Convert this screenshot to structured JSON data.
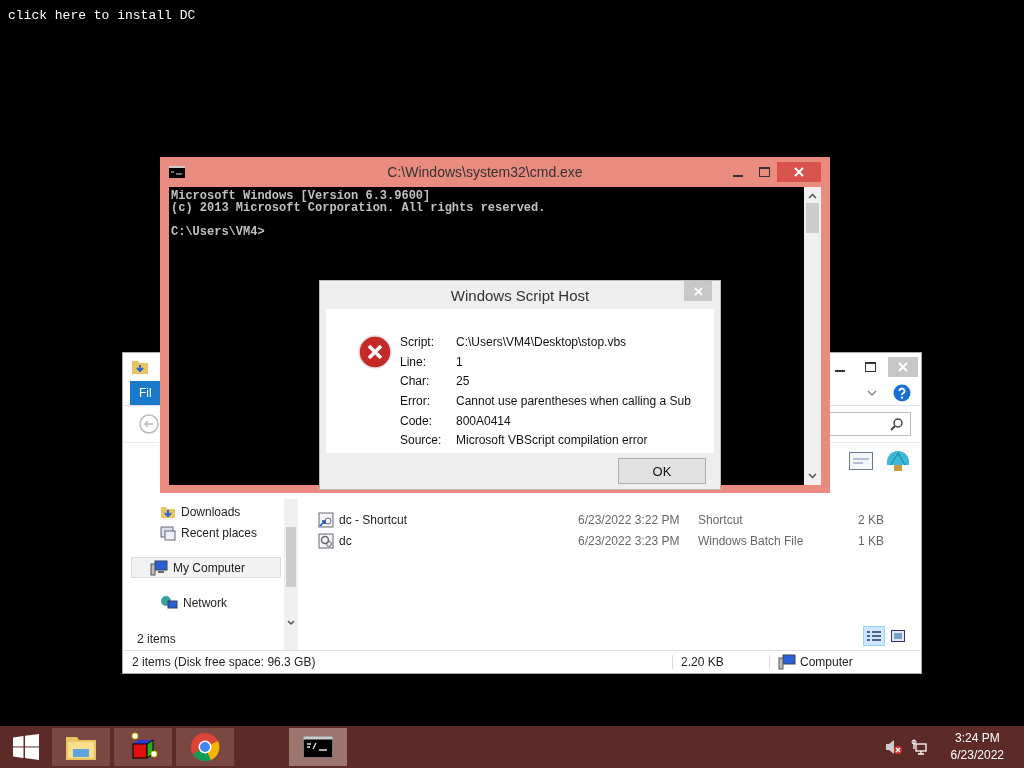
{
  "desktop_label": "click here to install DC",
  "explorer": {
    "tabs": [
      {
        "label": "Fil",
        "selected": true
      }
    ],
    "sidebar": {
      "groups": [
        {
          "items": [
            {
              "label": "Downloads",
              "kind": "downloads",
              "selected": false
            },
            {
              "label": "Recent places",
              "kind": "recent",
              "selected": false
            }
          ]
        },
        {
          "items": [
            {
              "label": "My Computer",
              "kind": "computer",
              "selected": true
            }
          ]
        },
        {
          "items": [
            {
              "label": "Network",
              "kind": "network",
              "selected": false
            }
          ]
        }
      ]
    },
    "item_count": "2 items",
    "files": [
      {
        "name": "dc - Shortcut",
        "kind": "shortcut",
        "date": "6/23/2022 3:22 PM",
        "type": "Shortcut",
        "size": "2 KB"
      },
      {
        "name": "dc",
        "kind": "batch",
        "date": "6/23/2022 3:23 PM",
        "type": "Windows Batch File",
        "size": "1 KB"
      }
    ],
    "views": [
      {
        "kind": "details",
        "selected": true
      },
      {
        "kind": "tiles",
        "selected": false
      }
    ],
    "status_bar": {
      "summary": "2 items (Disk free space: 96.3 GB)",
      "size": "2.20 KB",
      "location": "Computer"
    }
  },
  "console": {
    "title": "C:\\Windows\\system32\\cmd.exe",
    "lines": [
      "Microsoft Windows [Version 6.3.9600]",
      "(c) 2013 Microsoft Corporation. All rights reserved."
    ],
    "prompt": "C:\\Users\\VM4>"
  },
  "dialog": {
    "title": "Windows Script Host",
    "fields": [
      {
        "label": "Script:",
        "value": "C:\\Users\\VM4\\Desktop\\stop.vbs"
      },
      {
        "label": "Line:",
        "value": "1"
      },
      {
        "label": "Char:",
        "value": "25"
      },
      {
        "label": "Error:",
        "value": "Cannot use parentheses when calling a Sub"
      },
      {
        "label": "Code:",
        "value": "800A0414"
      },
      {
        "label": "Source:",
        "value": "Microsoft VBScript compilation error"
      }
    ],
    "button": "OK"
  },
  "taskbar": {
    "apps": [
      {
        "kind": "explorer",
        "active": false
      },
      {
        "kind": "cube",
        "active": false
      },
      {
        "kind": "chrome",
        "active": false
      },
      {
        "kind": "console",
        "active": true
      }
    ],
    "clock": {
      "time": "3:24 PM",
      "date": "6/23/2022"
    }
  }
}
